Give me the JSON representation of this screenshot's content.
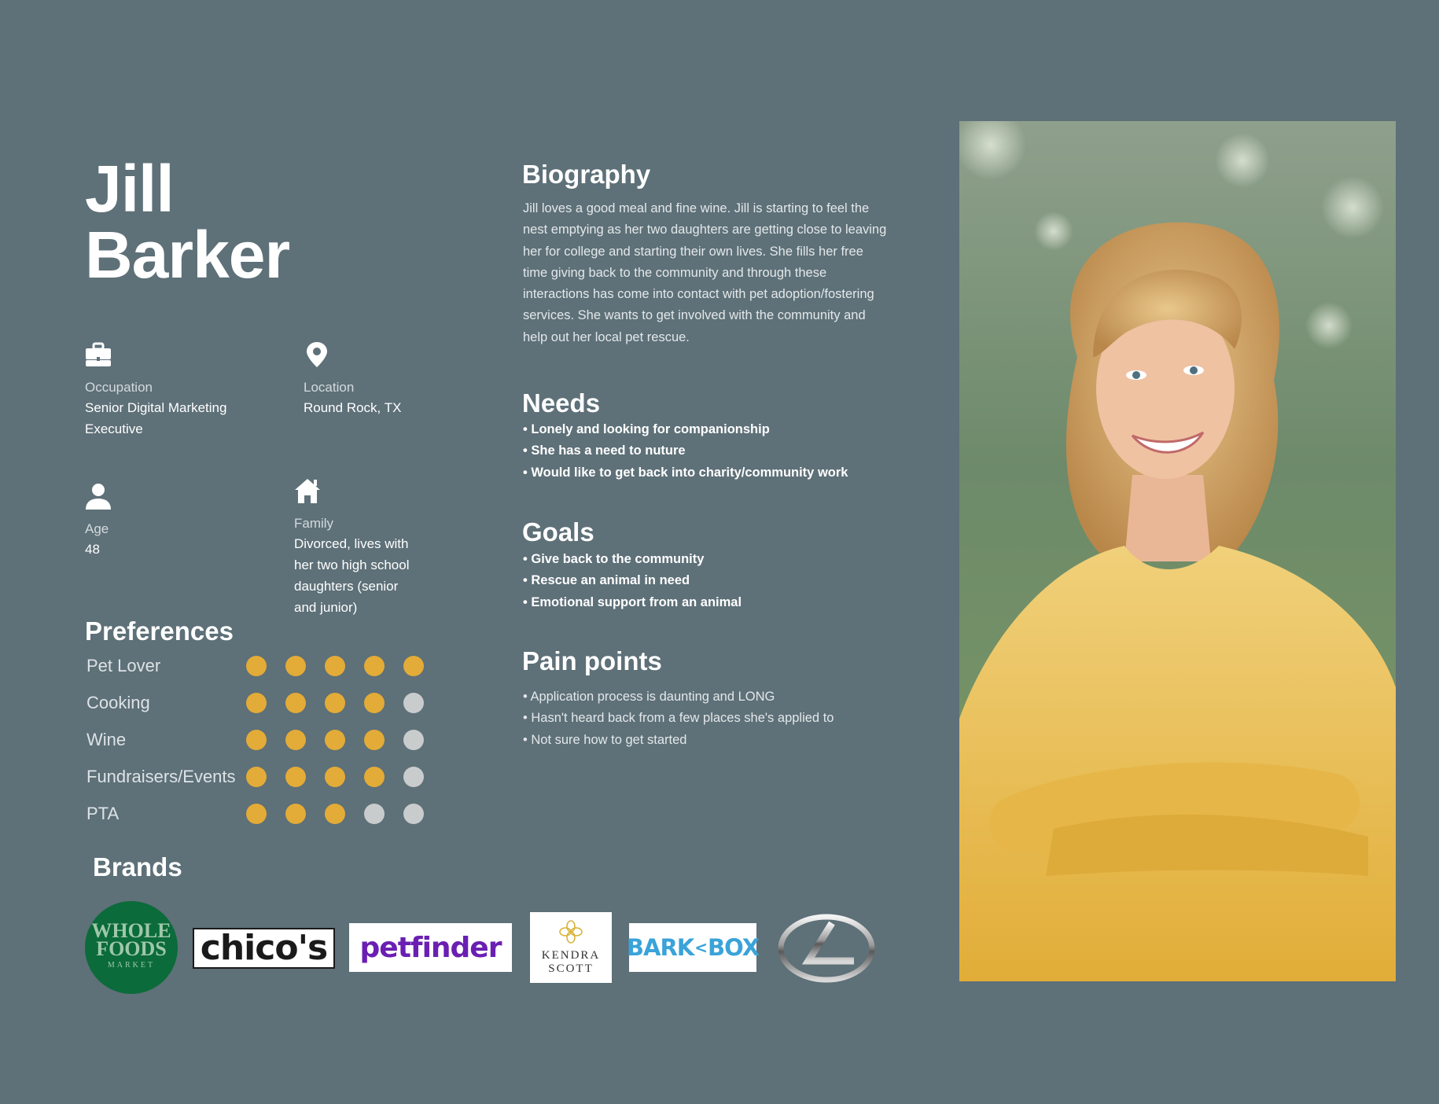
{
  "persona": {
    "first_name": "Jill",
    "last_name": "Barker"
  },
  "info": {
    "occupation": {
      "icon": "briefcase-icon",
      "label": "Occupation",
      "value_line1": "Senior Digital Marketing",
      "value_line2": "Executive"
    },
    "location": {
      "icon": "map-pin-icon",
      "label": "Location",
      "value": "Round Rock, TX"
    },
    "age": {
      "icon": "person-icon",
      "label": "Age",
      "value": "48"
    },
    "family": {
      "icon": "home-icon",
      "label": "Family",
      "lines": [
        "Divorced, lives with",
        "her two high school",
        "daughters (senior",
        "and junior)"
      ]
    }
  },
  "biography": {
    "title": "Biography",
    "lines": [
      "Jill loves a good meal and fine wine. Jill is starting to feel the",
      "nest emptying as her two daughters are getting close to leaving",
      "her for college and starting their own lives. She fills her free",
      "time giving back to the community and through these",
      "interactions has come into contact with pet adoption/fostering",
      "services. She wants to get involved with the community and",
      "help out her local pet rescue."
    ]
  },
  "needs": {
    "title": "Needs",
    "items": [
      "• Lonely and looking for companionship",
      "• She has a need to nuture",
      "• Would like to get back into charity/community work"
    ]
  },
  "goals": {
    "title": "Goals",
    "items": [
      "• Give back to the community",
      "• Rescue an animal in need",
      "• Emotional support from an animal"
    ]
  },
  "pain_points": {
    "title": "Pain points",
    "items": [
      "• Application process is daunting and LONG",
      "• Hasn't heard back from a few places she's applied to",
      "• Not sure how to get started"
    ]
  },
  "preferences": {
    "title": "Preferences",
    "max": 5,
    "items": [
      {
        "label": "Pet Lover",
        "rating": 5
      },
      {
        "label": "Cooking",
        "rating": 4
      },
      {
        "label": "Wine",
        "rating": 4
      },
      {
        "label": "Fundraisers/Events",
        "rating": 4
      },
      {
        "label": "PTA",
        "rating": 3
      }
    ],
    "colors": {
      "filled": "#e3ab37",
      "empty": "#c9cccd"
    }
  },
  "brands": {
    "title": "Brands",
    "logos": [
      {
        "name": "whole-foods-logo",
        "line1": "WHOLE",
        "line2": "FOODS",
        "line3": "MARKET"
      },
      {
        "name": "chicos-logo",
        "text": "chico's"
      },
      {
        "name": "petfinder-logo",
        "text": "petfinder"
      },
      {
        "name": "kendra-scott-logo",
        "line1": "KENDRA",
        "line2": "SCOTT"
      },
      {
        "name": "barkbox-logo",
        "left": "BARK",
        "right": "BOX"
      },
      {
        "name": "lexus-logo"
      }
    ]
  },
  "colors": {
    "background": "#5e7078",
    "accent": "#e3ab37"
  }
}
